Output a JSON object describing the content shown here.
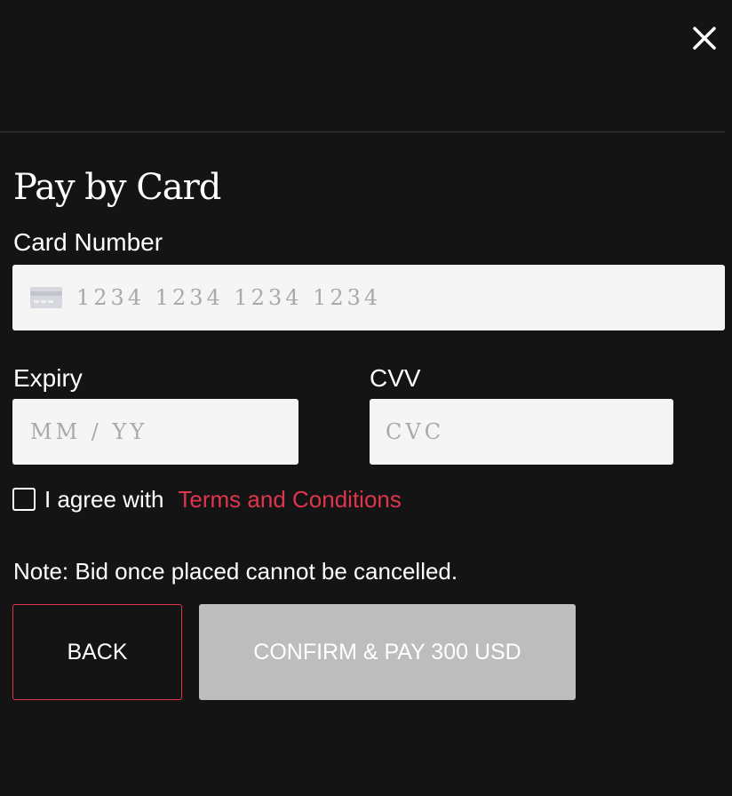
{
  "modal": {
    "close_icon": "close-icon",
    "title": "Pay by Card"
  },
  "card_number": {
    "label": "Card Number",
    "placeholder": "1234 1234 1234 1234",
    "value": "",
    "icon": "credit-card-icon"
  },
  "expiry": {
    "label": "Expiry",
    "placeholder": "MM / YY",
    "value": ""
  },
  "cvv": {
    "label": "CVV",
    "placeholder": "CVC",
    "value": ""
  },
  "agreement": {
    "checked": false,
    "text": "I agree with",
    "link_text": "Terms and Conditions"
  },
  "note": "Note: Bid once placed cannot be cancelled.",
  "buttons": {
    "back_label": "BACK",
    "confirm_label": "CONFIRM & PAY 300 USD"
  },
  "colors": {
    "background": "#141414",
    "accent": "#e0344d",
    "input_background": "#f5f5f5",
    "confirm_disabled": "#bdbdbd"
  }
}
